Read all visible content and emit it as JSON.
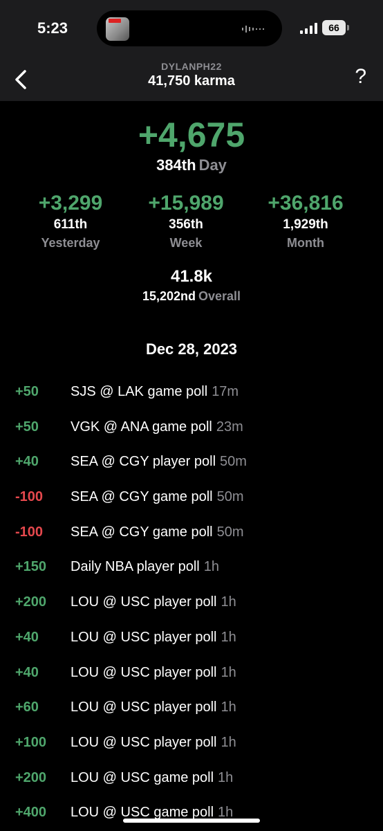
{
  "status_bar": {
    "time": "5:23",
    "battery": "66"
  },
  "nav": {
    "username": "DYLANPH22",
    "karma": "41,750 karma",
    "help": "?"
  },
  "summary": {
    "delta": "+4,675",
    "rank": "384th",
    "period": "Day"
  },
  "stats": [
    {
      "delta": "+3,299",
      "rank": "611th",
      "label": "Yesterday"
    },
    {
      "delta": "+15,989",
      "rank": "356th",
      "label": "Week"
    },
    {
      "delta": "+36,816",
      "rank": "1,929th",
      "label": "Month"
    }
  ],
  "overall": {
    "value": "41.8k",
    "rank": "15,202nd",
    "label": "Overall"
  },
  "date": "Dec 28, 2023",
  "colors": {
    "positive": "#4fa66c",
    "negative": "#e5484d",
    "muted": "#8e8e93",
    "header_bg": "#1c1c1e"
  },
  "activities": [
    {
      "delta": "+50",
      "sign": "pos",
      "title": "SJS @ LAK game poll",
      "time": "17m"
    },
    {
      "delta": "+50",
      "sign": "pos",
      "title": "VGK @ ANA game poll",
      "time": "23m"
    },
    {
      "delta": "+40",
      "sign": "pos",
      "title": "SEA @ CGY player poll",
      "time": "50m"
    },
    {
      "delta": "-100",
      "sign": "neg",
      "title": "SEA @ CGY game poll",
      "time": "50m"
    },
    {
      "delta": "-100",
      "sign": "neg",
      "title": "SEA @ CGY game poll",
      "time": "50m"
    },
    {
      "delta": "+150",
      "sign": "pos",
      "title": "Daily NBA player poll",
      "time": "1h"
    },
    {
      "delta": "+200",
      "sign": "pos",
      "title": "LOU @ USC player poll",
      "time": "1h"
    },
    {
      "delta": "+40",
      "sign": "pos",
      "title": "LOU @ USC player poll",
      "time": "1h"
    },
    {
      "delta": "+40",
      "sign": "pos",
      "title": "LOU @ USC player poll",
      "time": "1h"
    },
    {
      "delta": "+60",
      "sign": "pos",
      "title": "LOU @ USC player poll",
      "time": "1h"
    },
    {
      "delta": "+100",
      "sign": "pos",
      "title": "LOU @ USC player poll",
      "time": "1h"
    },
    {
      "delta": "+200",
      "sign": "pos",
      "title": "LOU @ USC game poll",
      "time": "1h"
    },
    {
      "delta": "+400",
      "sign": "pos",
      "title": "LOU @ USC game poll",
      "time": "1h"
    }
  ]
}
